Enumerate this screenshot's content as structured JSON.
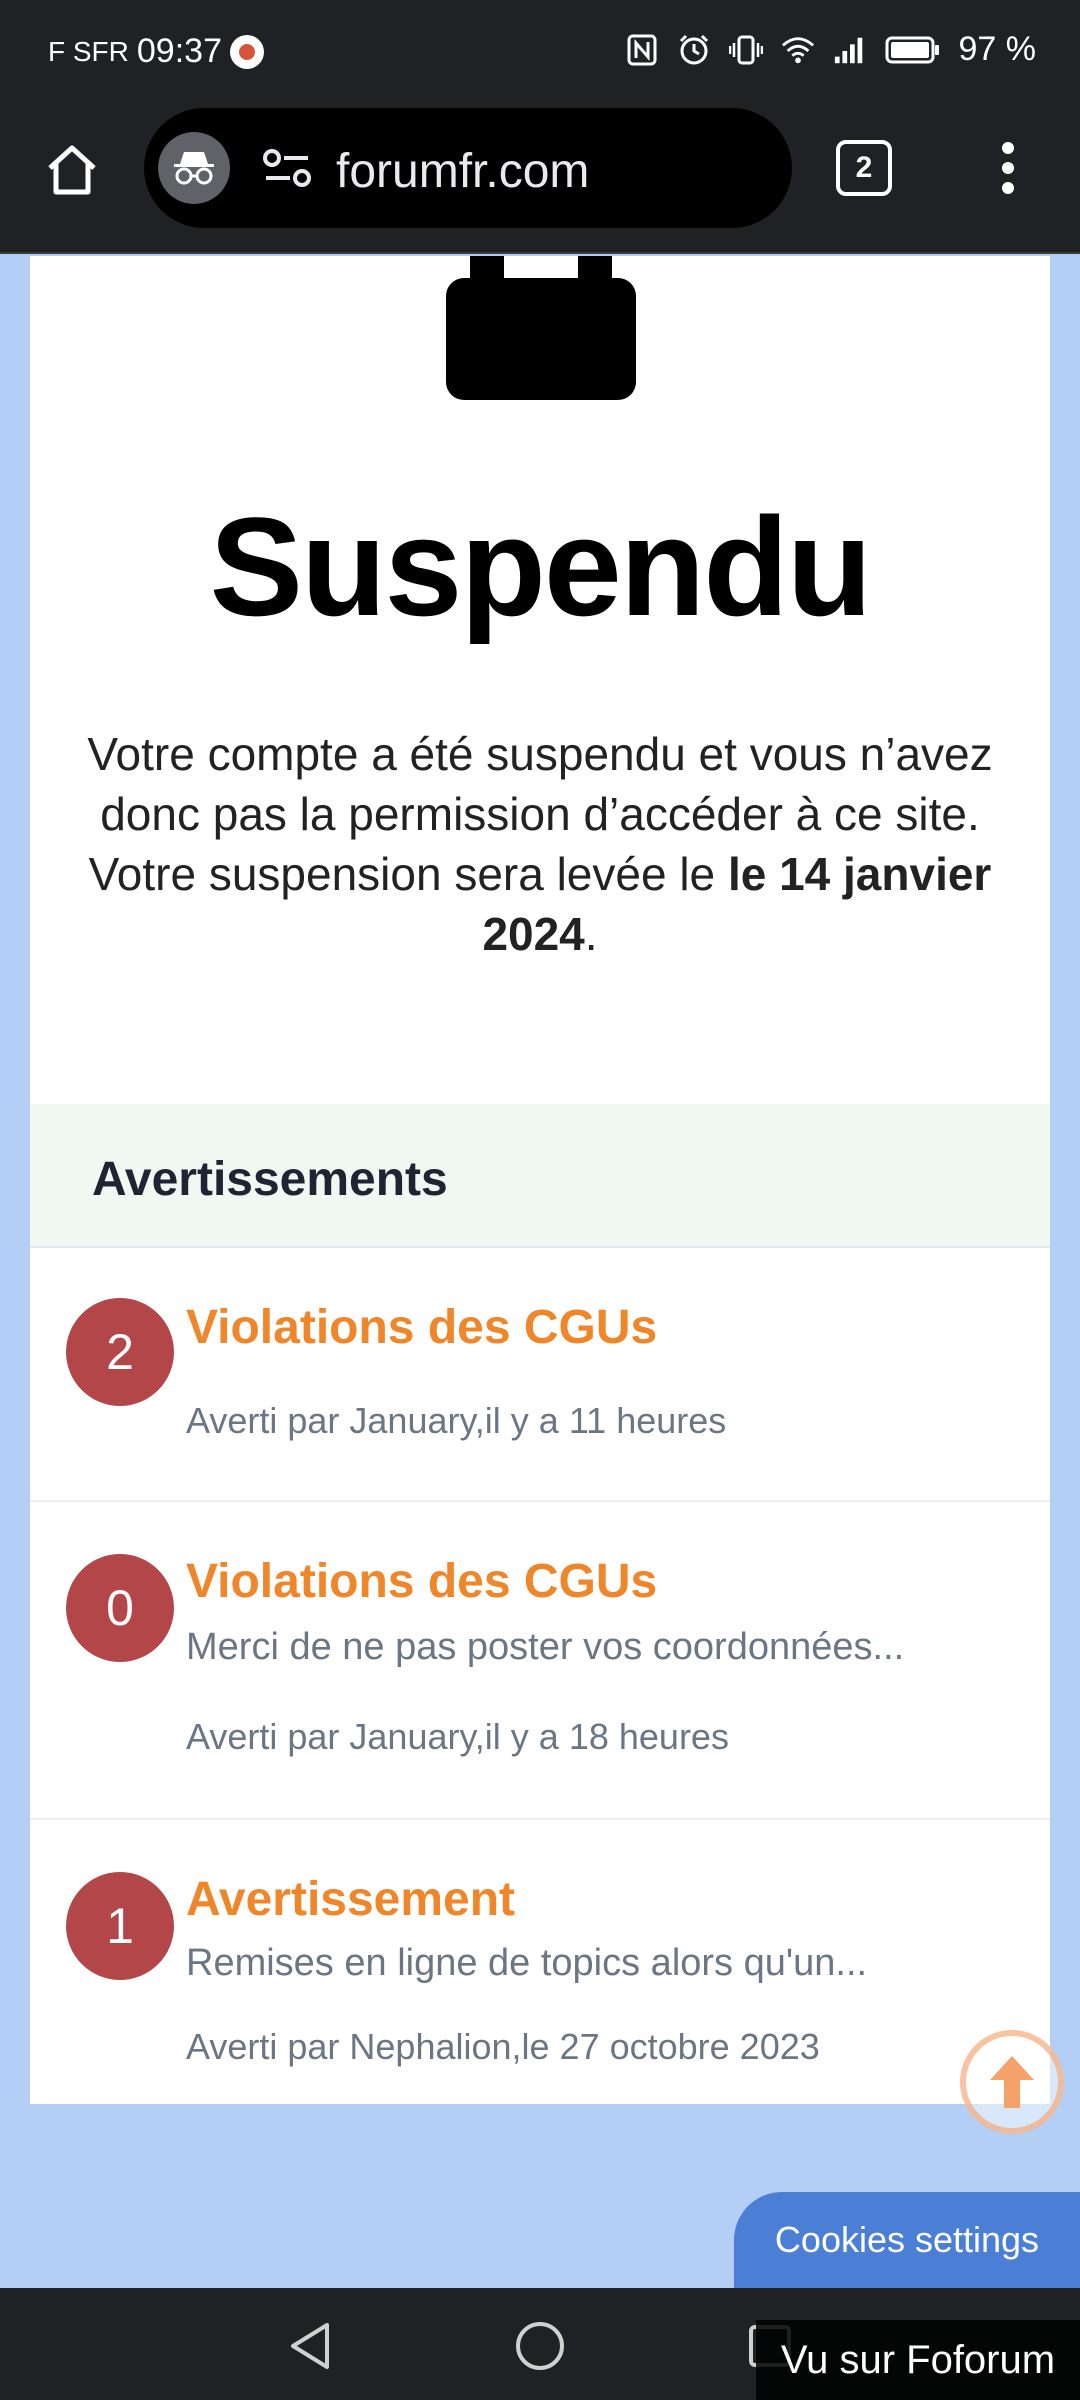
{
  "status_bar": {
    "carrier": "F SFR",
    "time": "09:37",
    "battery": "97 %",
    "icons": [
      "nfc-icon",
      "alarm-icon",
      "vibrate-icon",
      "wifi-icon",
      "signal-icon",
      "battery-icon"
    ]
  },
  "browser": {
    "url": "forumfr.com",
    "tab_count": "2"
  },
  "suspension": {
    "title": "Suspendu",
    "message_line1": "Votre compte a été suspendu et vous n’avez donc pas la permission d’accéder à ce site.",
    "message_line2_prefix": "Votre suspension sera levée le ",
    "message_line2_date": "le 14 janvier 2024",
    "message_line2_suffix": "."
  },
  "warnings": {
    "header": "Avertissements",
    "items": [
      {
        "count": "2",
        "title": "Violations des CGUs",
        "description": "",
        "meta": "Averti par January,il y a 11 heures"
      },
      {
        "count": "0",
        "title": "Violations des CGUs",
        "description": "Merci de ne pas poster vos coordonnées...",
        "meta": "Averti par January,il y a 18 heures"
      },
      {
        "count": "1",
        "title": "Avertissement",
        "description": "Remises en ligne de topics alors qu'un...",
        "meta": "Averti par Nephalion,le 27 octobre 2023"
      }
    ]
  },
  "cookies_button": "Cookies settings",
  "watermark": "Vu sur Foforum",
  "colors": {
    "page_background": "#b3cff5",
    "accent_orange": "#f0862a",
    "badge_red": "#b34648",
    "cookies_blue": "#4b7fd6"
  }
}
